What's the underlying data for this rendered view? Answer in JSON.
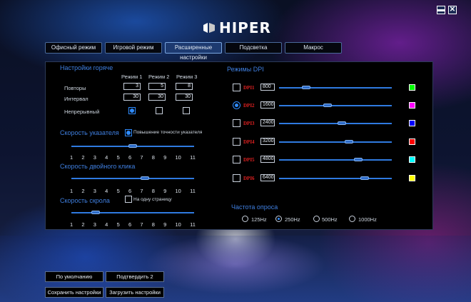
{
  "window": {
    "minimize_label": "▬",
    "close_label": "✕"
  },
  "logo": {
    "text": "HIPER"
  },
  "tabs": [
    {
      "label": "Офисный режим",
      "active": false
    },
    {
      "label": "Игровой режим",
      "active": false
    },
    {
      "label": "Расширенные настройки",
      "active": true
    },
    {
      "label": "Подсветка",
      "active": false
    },
    {
      "label": "Макрос",
      "active": false
    }
  ],
  "hotkeys": {
    "title": "Настройки горяче",
    "modes": [
      "Режим 1",
      "Режим 2",
      "Режим 3"
    ],
    "rows": [
      {
        "label": "Повторы",
        "values": [
          "3",
          "5",
          "8"
        ]
      },
      {
        "label": "Интервал",
        "values": [
          "30",
          "30",
          "30"
        ]
      }
    ],
    "continuous_label": "Непрерывный",
    "continuous_checked": [
      true,
      false,
      false
    ]
  },
  "pointer_speed": {
    "title": "Скорость указателя",
    "precision_label": "Повышение точности указателя",
    "precision_checked": true,
    "value": 6,
    "ticks": [
      "1",
      "2",
      "3",
      "4",
      "5",
      "6",
      "7",
      "8",
      "9",
      "10",
      "11"
    ]
  },
  "double_click": {
    "title": "Скорость двойного клика",
    "value": 7,
    "ticks": [
      "1",
      "2",
      "3",
      "4",
      "5",
      "6",
      "7",
      "8",
      "9",
      "10",
      "11"
    ]
  },
  "scroll": {
    "title": "Скорость скрола",
    "one_page_label": "На одну страницу",
    "one_page_checked": false,
    "value": 3,
    "ticks": [
      "1",
      "2",
      "3",
      "4",
      "5",
      "6",
      "7",
      "8",
      "9",
      "10",
      "11"
    ]
  },
  "dpi": {
    "title": "Режимы DPI",
    "levels": [
      {
        "label": "DPI1",
        "value": "800",
        "fraction": 0.24,
        "color": "#00ff00",
        "active": false
      },
      {
        "label": "DPI2",
        "value": "1600",
        "fraction": 0.43,
        "color": "#ff00ff",
        "active": true
      },
      {
        "label": "DPI3",
        "value": "2400",
        "fraction": 0.56,
        "color": "#0000ff",
        "active": false
      },
      {
        "label": "DPI4",
        "value": "3200",
        "fraction": 0.62,
        "color": "#ff0000",
        "active": false
      },
      {
        "label": "DPI5",
        "value": "4800",
        "fraction": 0.7,
        "color": "#00ffff",
        "active": false
      },
      {
        "label": "DPI6",
        "value": "6400",
        "fraction": 0.76,
        "color": "#ffff00",
        "active": false
      }
    ]
  },
  "polling": {
    "title": "Частота опроса",
    "options": [
      {
        "label": "125Hz",
        "selected": false
      },
      {
        "label": "250Hz",
        "selected": true
      },
      {
        "label": "500Hz",
        "selected": false
      },
      {
        "label": "1000Hz",
        "selected": false
      }
    ]
  },
  "buttons": {
    "default": "По умолчанию",
    "confirm": "Подтвердить 2",
    "save": "Сохранить настройки",
    "load": "Загрузить настройки"
  }
}
